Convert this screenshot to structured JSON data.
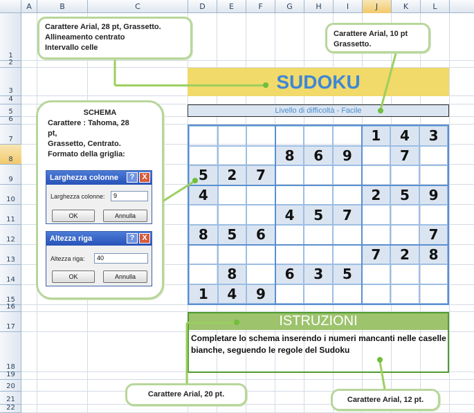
{
  "sheet": {
    "columns": [
      "A",
      "B",
      "C",
      "D",
      "E",
      "F",
      "G",
      "H",
      "I",
      "J",
      "K",
      "L"
    ],
    "rows": [
      "1",
      "2",
      "3",
      "4",
      "5",
      "6",
      "7",
      "8",
      "9",
      "10",
      "11",
      "12",
      "13",
      "14",
      "15",
      "16",
      "17",
      "18",
      "19",
      "20",
      "21",
      "22"
    ],
    "highlight_row": "8",
    "highlight_column": "J"
  },
  "callouts": {
    "top_left": [
      "Carattere Arial, 28 pt, Grassetto.",
      "Allineamento centrato",
      "Intervallo celle"
    ],
    "top_right": [
      "Carattere Arial, 10 pt",
      "Grassetto."
    ],
    "schema": {
      "heading": "SCHEMA",
      "lines": [
        "Carattere : Tahoma, 28",
        "pt,",
        "Grassetto, Centrato.",
        "Formato della  griglia:"
      ]
    },
    "bottom_left": "Carattere Arial, 20 pt.",
    "bottom_right": "Carattere Arial, 12 pt."
  },
  "title": "SUDOKU",
  "level": "Livello di difficoltà - Facile",
  "grid": [
    [
      "",
      "",
      "",
      "",
      "",
      "",
      "1",
      "4",
      "3"
    ],
    [
      "",
      "",
      "",
      "8",
      "6",
      "9",
      "",
      "7",
      ""
    ],
    [
      "5",
      "2",
      "7",
      "",
      "",
      "",
      "",
      "",
      ""
    ],
    [
      "4",
      "",
      "",
      "",
      "",
      "",
      "2",
      "5",
      "9"
    ],
    [
      "",
      "",
      "",
      "4",
      "5",
      "7",
      "",
      "",
      ""
    ],
    [
      "8",
      "5",
      "6",
      "",
      "",
      "",
      "",
      "",
      "7"
    ],
    [
      "",
      "",
      "",
      "",
      "",
      "",
      "7",
      "2",
      "8"
    ],
    [
      "",
      "8",
      "",
      "6",
      "3",
      "5",
      "",
      "",
      ""
    ],
    [
      "1",
      "4",
      "9",
      "",
      "",
      "",
      "",
      "",
      ""
    ]
  ],
  "instructions": {
    "heading": "ISTRUZIONI",
    "text": "Completare lo schema inserendo i numeri mancanti nelle caselle bianche,  seguendo le regole del Sudoku"
  },
  "dialogs": {
    "col_width": {
      "title": "Larghezza colonne",
      "label": "Larghezza colonne:",
      "value": "9",
      "ok": "OK",
      "cancel": "Annulla",
      "help": "?",
      "close": "X"
    },
    "row_height": {
      "title": "Altezza riga",
      "label": "Altezza riga:",
      "value": "40",
      "ok": "OK",
      "cancel": "Annulla",
      "help": "?",
      "close": "X"
    }
  },
  "colors": {
    "title_band": "#f1d96a",
    "title_text": "#3f87d4",
    "instr_head": "#9dc36d",
    "callout_border": "#b7d69a"
  }
}
